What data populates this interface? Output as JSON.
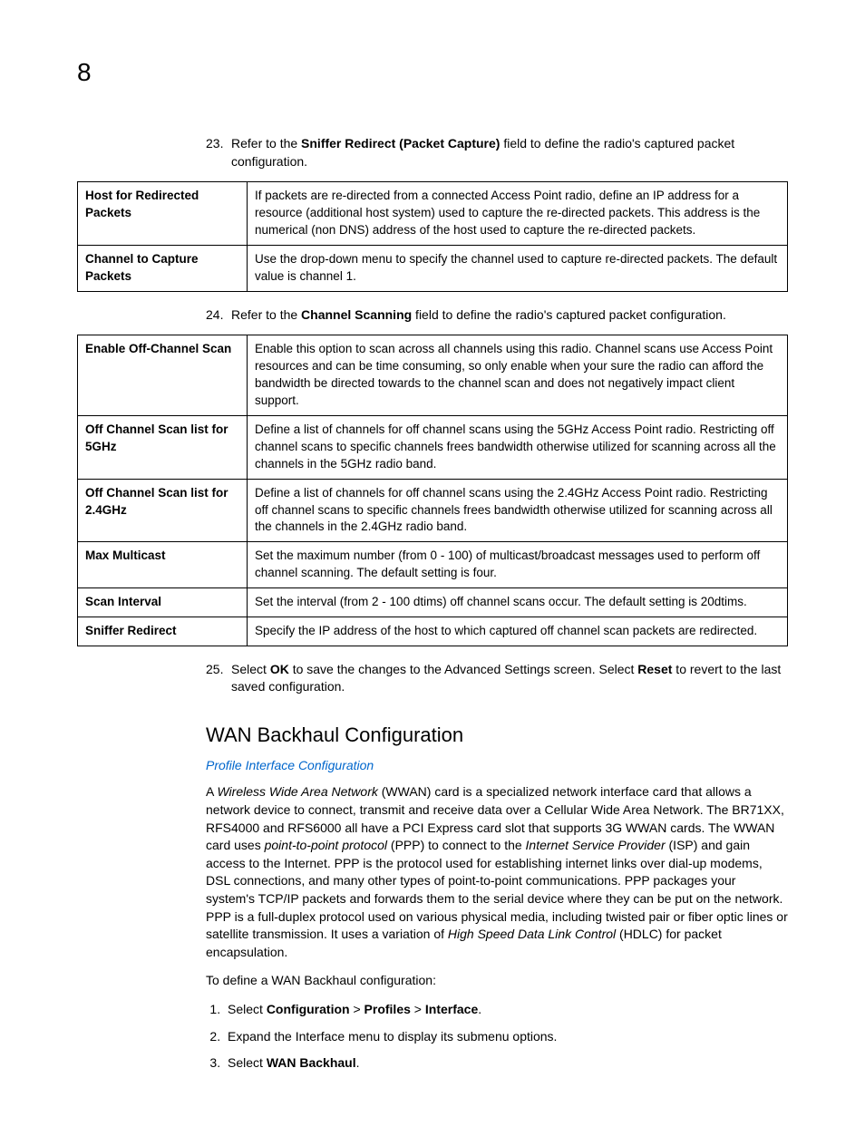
{
  "pageNumber": "8",
  "step23": {
    "num": "23.",
    "pre": "Refer to the ",
    "bold": "Sniffer Redirect (Packet Capture)",
    "post": " field to define the radio's captured packet configuration."
  },
  "table1": {
    "r1": {
      "label": "Host for Redirected Packets",
      "desc": "If packets are re-directed from a connected Access Point radio, define an IP address for a resource (additional host system) used to capture the re-directed packets. This address is the numerical (non DNS) address of the host used to capture the re-directed packets."
    },
    "r2": {
      "label": "Channel to Capture Packets",
      "desc": "Use the drop-down menu to specify the channel used to capture re-directed packets. The default value is channel 1."
    }
  },
  "step24": {
    "num": "24.",
    "pre": " Refer to the ",
    "bold": "Channel Scanning",
    "post": " field to define the radio's captured packet configuration."
  },
  "table2": {
    "r1": {
      "label": "Enable Off-Channel Scan",
      "desc": "Enable this option to scan across all channels using this radio. Channel scans use Access Point resources and can be time consuming, so only enable when your sure the radio can afford the bandwidth be directed towards to the channel scan and does not negatively impact client support."
    },
    "r2": {
      "label": "Off Channel Scan list for 5GHz",
      "desc": "Define a list of channels for off channel scans using the 5GHz Access Point radio. Restricting off channel scans to specific channels frees bandwidth otherwise utilized for scanning across all the channels in the 5GHz radio band."
    },
    "r3": {
      "label": "Off Channel Scan list for 2.4GHz",
      "desc": "Define a list of channels for off channel scans using the 2.4GHz Access Point radio. Restricting off channel scans to specific channels frees bandwidth otherwise utilized for scanning across all the channels in the 2.4GHz radio band."
    },
    "r4": {
      "label": "Max Multicast",
      "desc": "Set the maximum number (from 0 - 100) of multicast/broadcast messages used to perform off channel scanning. The default setting is four."
    },
    "r5": {
      "label": "Scan Interval",
      "desc": "Set the interval (from 2 - 100 dtims) off channel scans occur. The default setting is 20dtims."
    },
    "r6": {
      "label": "Sniffer Redirect",
      "desc": "Specify the IP address of the host to which captured off channel scan packets are redirected."
    }
  },
  "step25": {
    "num": "25.",
    "pre": "Select ",
    "b1": "OK",
    "mid": " to save the changes to the Advanced Settings screen. Select ",
    "b2": "Reset",
    "post": " to revert to the last saved configuration."
  },
  "heading": "WAN Backhaul Configuration",
  "link": "Profile Interface Configuration",
  "para1": {
    "t1": "A ",
    "i1": "Wireless Wide Area Network",
    "t2": " (WWAN) card is a specialized network interface card that allows a network device to connect, transmit and receive data over a Cellular Wide Area Network. The BR71XX, RFS4000 and RFS6000 all have a PCI Express card slot that supports 3G WWAN cards. The WWAN card uses ",
    "i2": "point-to-point protocol",
    "t3": " (PPP) to connect to the ",
    "i3": "Internet Service Provider",
    "t4": " (ISP) and gain access to the Internet. PPP is the protocol used for establishing internet links over dial-up modems, DSL connections, and many other types of point-to-point communications. PPP packages your system's TCP/IP packets and forwards them to the serial device where they can be put on the network. PPP is a full-duplex protocol used on various physical media, including twisted pair or fiber optic lines or satellite transmission. It uses a variation of ",
    "i4": "High Speed Data Link Control",
    "t5": " (HDLC) for packet encapsulation."
  },
  "para2": "To define a WAN Backhaul configuration:",
  "ol": {
    "s1": {
      "pre": "Select ",
      "b1": "Configuration",
      "sep1": " > ",
      "b2": "Profiles",
      "sep2": " > ",
      "b3": "Interface",
      "post": "."
    },
    "s2": "Expand the Interface menu to display its submenu options.",
    "s3": {
      "pre": "Select ",
      "b1": "WAN Backhaul",
      "post": "."
    }
  }
}
